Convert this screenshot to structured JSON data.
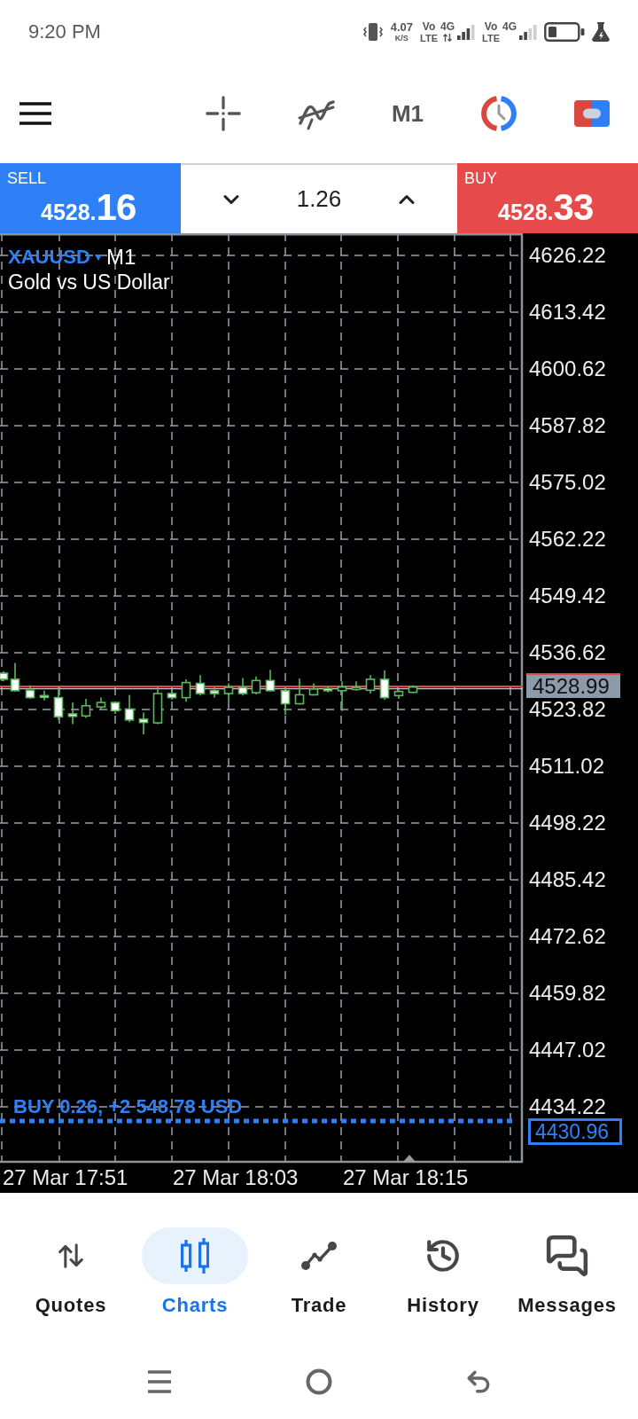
{
  "status_bar": {
    "time": "9:20 PM",
    "net_speed": "4.07",
    "net_unit": "K/S",
    "sims": [
      {
        "volte": "Vo",
        "lte": "LTE",
        "network": "4G",
        "data": true
      },
      {
        "volte": "Vo",
        "lte": "LTE",
        "network": "4G",
        "data": false
      }
    ]
  },
  "toolbar": {
    "timeframe": "M1"
  },
  "trade_panel": {
    "sell": {
      "label": "SELL",
      "price_prefix": "4528.",
      "price_pips": "16"
    },
    "volume": "1.26",
    "buy": {
      "label": "BUY",
      "price_prefix": "4528.",
      "price_pips": "33"
    }
  },
  "chart": {
    "symbol": "XAUUSD",
    "timeframe": "M1",
    "description": "Gold vs US Dollar",
    "price_labels": [
      "4626.22",
      "4613.42",
      "4600.62",
      "4587.82",
      "4575.02",
      "4562.22",
      "4549.42",
      "4536.62",
      "4523.82",
      "4511.02",
      "4498.22",
      "4485.42",
      "4472.62",
      "4459.82",
      "4447.02",
      "4434.22"
    ],
    "current_price": "4528.99",
    "position": {
      "label": "BUY 0.26, +2 548.78 USD",
      "price": "4430.96"
    },
    "time_labels": [
      "27 Mar 17:51",
      "27 Mar 18:03",
      "27 Mar 18:15"
    ]
  },
  "bottom_nav": [
    {
      "label": "Quotes",
      "selected": false
    },
    {
      "label": "Charts",
      "selected": true
    },
    {
      "label": "Trade",
      "selected": false
    },
    {
      "label": "History",
      "selected": false
    },
    {
      "label": "Messages",
      "selected": false
    }
  ]
}
